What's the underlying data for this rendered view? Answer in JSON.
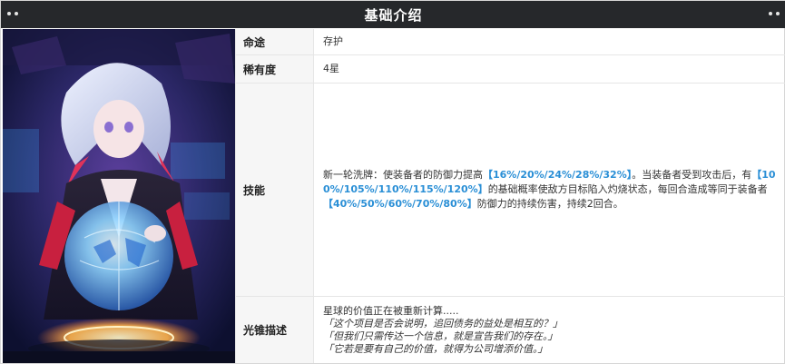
{
  "header": {
    "title": "基础介绍"
  },
  "portrait": {
    "icon": "character-portrait"
  },
  "rows": {
    "path": {
      "label": "命途",
      "value": "存护"
    },
    "rarity": {
      "label": "稀有度",
      "value": "4星"
    },
    "skill": {
      "label": "技能",
      "parts": [
        {
          "text": "新一轮洗牌：使装备者的防御力提高",
          "hl": false
        },
        {
          "text": "【16%/20%/24%/28%/32%】",
          "hl": true
        },
        {
          "text": "。当装备者受到攻击后，有",
          "hl": false
        },
        {
          "text": "【100%/105%/110%/115%/120%】",
          "hl": true
        },
        {
          "text": "的基础概率使敌方目标陷入灼烧状态，每回合造成等同于装备者",
          "hl": false
        },
        {
          "text": "【40%/50%/60%/70%/80%】",
          "hl": true
        },
        {
          "text": "防御力的持续伤害，持续2回合。",
          "hl": false
        }
      ]
    },
    "desc": {
      "label": "光锥描述",
      "lines": [
        "星球的价值正在被重新计算.....",
        "「这个项目是否会说明，追回债务的益处是相互的？」",
        "「但我们只需传达一个信息，就是宣告我们的存在。」",
        "「它若是要有自己的价值，就得为公司增添价值。」"
      ]
    }
  },
  "colors": {
    "header_bg": "#26282b",
    "highlight": "#2a8fd6"
  }
}
